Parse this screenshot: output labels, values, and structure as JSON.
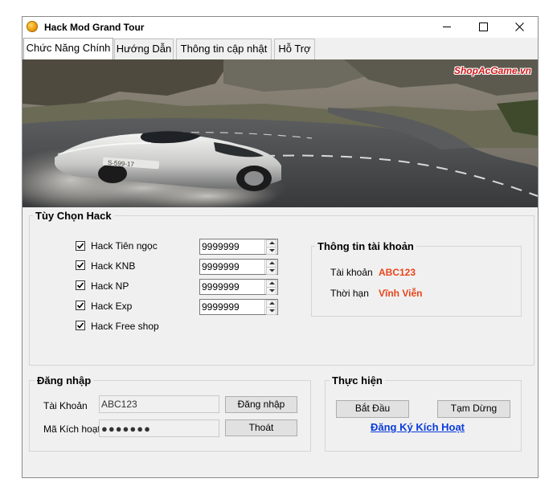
{
  "window": {
    "title": "Hack Mod Grand Tour",
    "controls": [
      "minimize-icon",
      "maximize-icon",
      "close-icon"
    ]
  },
  "tabs": [
    {
      "label": "Chức Năng Chính",
      "active": true
    },
    {
      "label": "Hướng Dẫn",
      "active": false
    },
    {
      "label": "Thông tin cập nhật",
      "active": false
    },
    {
      "label": "Hỗ Trợ",
      "active": false
    }
  ],
  "banner": {
    "watermark": "ShopAcGame.vn",
    "plate_text": "S-599-17"
  },
  "hack_options": {
    "title": "Tùy Chọn Hack",
    "items": [
      {
        "label": "Hack Tiên ngọc",
        "checked": true,
        "value": "9999999"
      },
      {
        "label": "Hack KNB",
        "checked": true,
        "value": "9999999"
      },
      {
        "label": "Hack NP",
        "checked": true,
        "value": "9999999"
      },
      {
        "label": "Hack Exp",
        "checked": true,
        "value": "9999999"
      },
      {
        "label": "Hack Free shop",
        "checked": true
      }
    ]
  },
  "account_info": {
    "title": "Thông tin tài khoản",
    "account_label": "Tài khoản",
    "account_value": "ABC123",
    "duration_label": "Thời hạn",
    "duration_value": "Vĩnh Viễn",
    "value_color": "#e8451b"
  },
  "login": {
    "title": "Đăng nhập",
    "account_label": "Tài Khoản",
    "account_value": "ABC123",
    "code_label": "Mã Kích hoạt",
    "code_value": "●●●●●●●",
    "login_button": "Đăng nhập",
    "exit_button": "Thoát"
  },
  "actions": {
    "title": "Thực hiện",
    "start_button": "Bắt Đầu",
    "pause_button": "Tạm Dừng",
    "register_link": "Đăng Ký Kích Hoạt",
    "link_color": "#0a3cdc"
  }
}
